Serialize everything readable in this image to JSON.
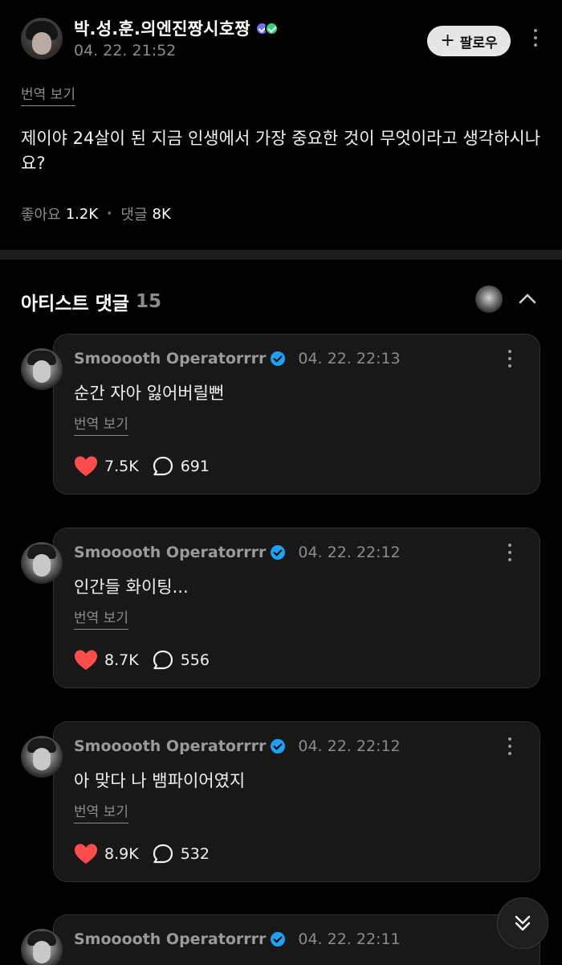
{
  "post": {
    "author": "박.성.훈.의엔진짱시호짱",
    "time": "04. 22. 21:52",
    "follow_label": "팔로우",
    "translate_label": "번역 보기",
    "body": "제이야 24살이 된 지금 인생에서 가장 중요한 것이 무엇이라고 생각하시나요?",
    "likes_label": "좋아요",
    "likes_count": "1.2K",
    "comments_label": "댓글",
    "comments_count": "8K"
  },
  "artist_comments": {
    "title": "아티스트 댓글",
    "count": "15",
    "items": [
      {
        "name": "Smooooth Operatorrrr",
        "time": "04. 22. 22:13",
        "text": "순간 자아 잃어버릴뻔",
        "translate_label": "번역 보기",
        "likes": "7.5K",
        "replies": "691"
      },
      {
        "name": "Smooooth Operatorrrr",
        "time": "04. 22. 22:12",
        "text": "인간들 화이팅...",
        "translate_label": "번역 보기",
        "likes": "8.7K",
        "replies": "556"
      },
      {
        "name": "Smooooth Operatorrrr",
        "time": "04. 22. 22:12",
        "text": "아 맞다 나 뱀파이어였지",
        "translate_label": "번역 보기",
        "likes": "8.9K",
        "replies": "532"
      },
      {
        "name": "Smooooth Operatorrrr",
        "time": "04. 22. 22:11"
      }
    ]
  },
  "colors": {
    "heart": "#ff4d4d",
    "verified": "#1da1f2",
    "background": "#000000",
    "card": "#181818"
  }
}
